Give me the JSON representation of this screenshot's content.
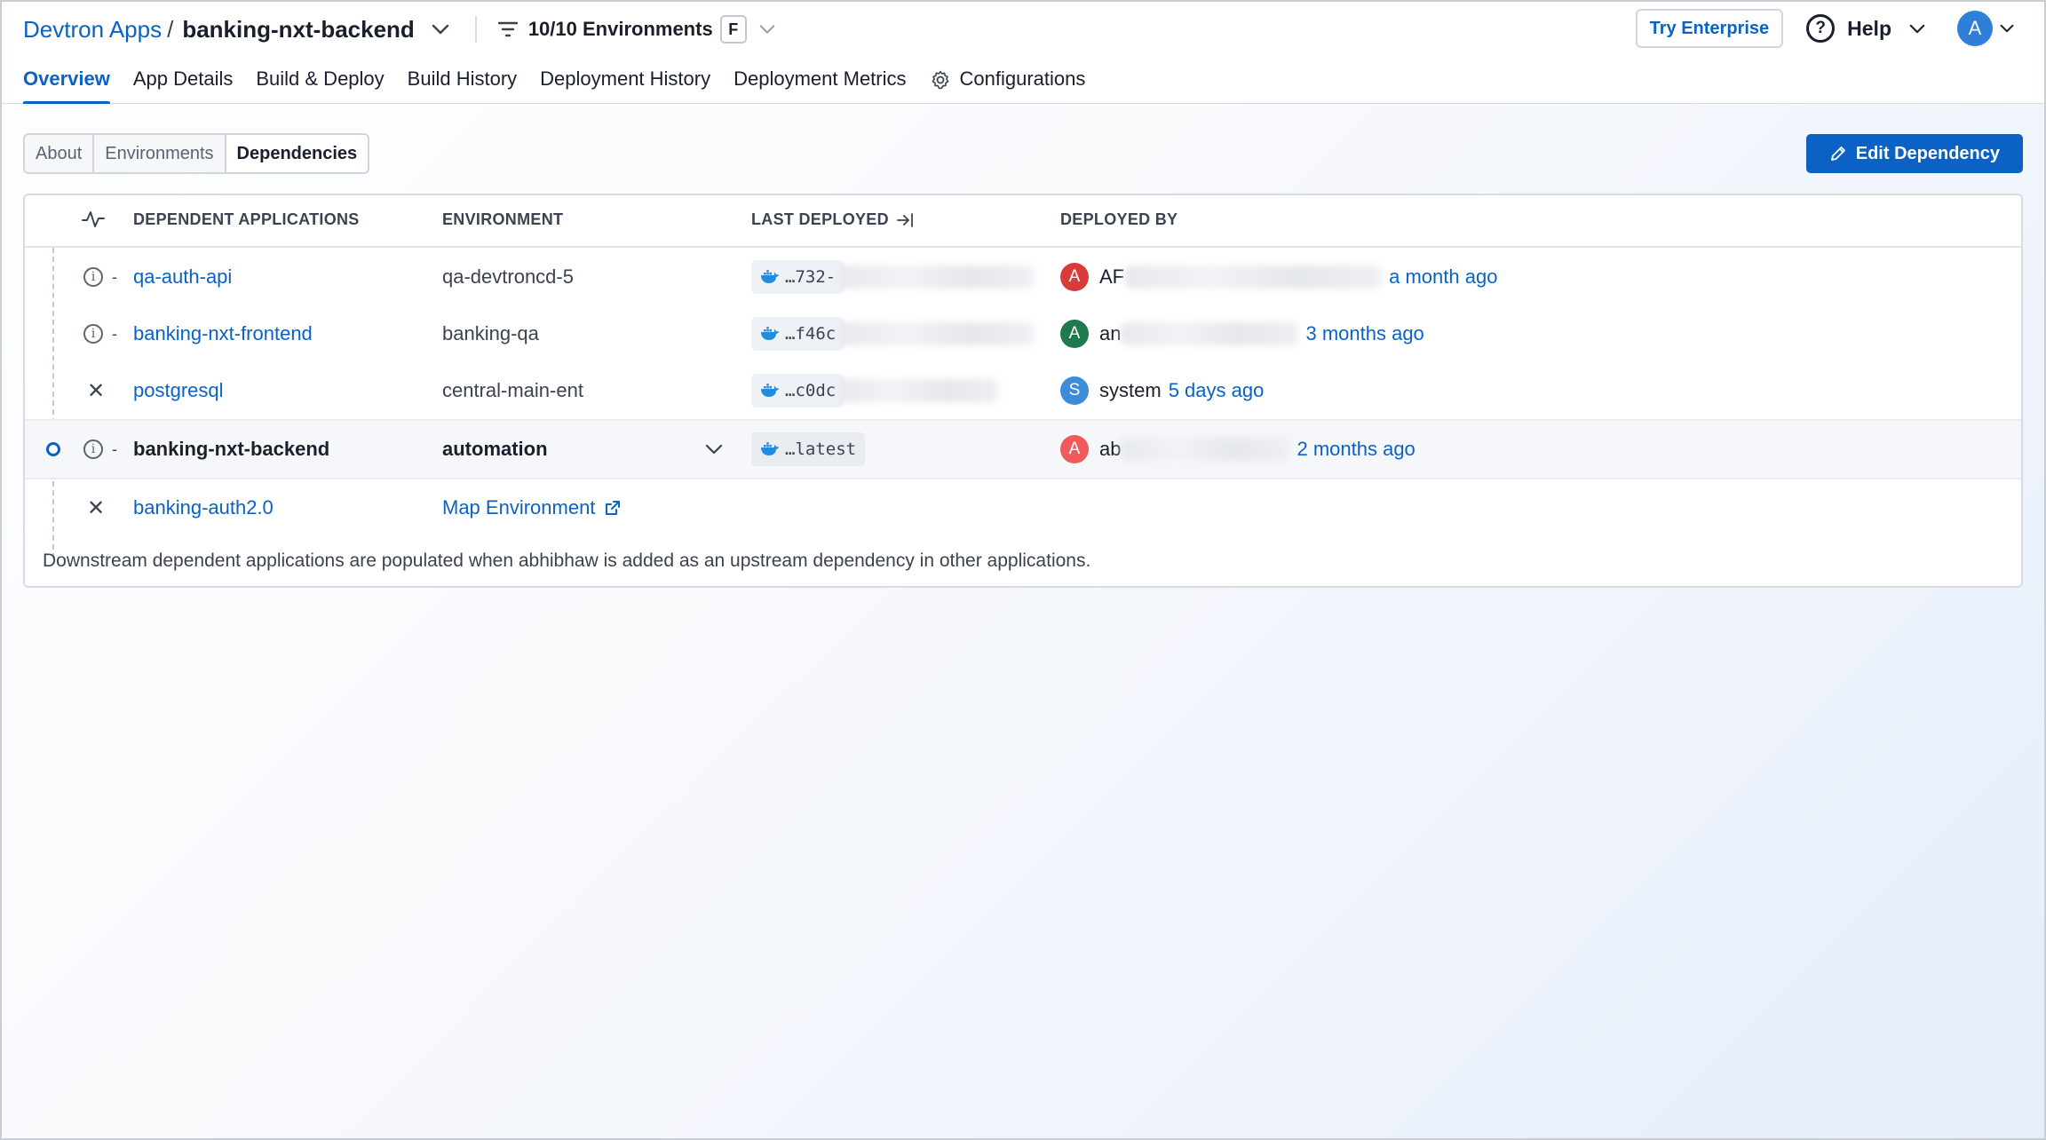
{
  "breadcrumb": {
    "root": "Devtron Apps",
    "separator": "/",
    "app": "banking-nxt-backend"
  },
  "env_filter": {
    "label": "10/10 Environments",
    "shortcut": "F"
  },
  "topright": {
    "enterprise": "Try Enterprise",
    "help": "Help",
    "avatar": "A"
  },
  "tabs": [
    {
      "label": "Overview",
      "active": true
    },
    {
      "label": "App Details"
    },
    {
      "label": "Build & Deploy"
    },
    {
      "label": "Build History"
    },
    {
      "label": "Deployment History"
    },
    {
      "label": "Deployment Metrics"
    },
    {
      "label": "Configurations",
      "icon": "gear-icon"
    }
  ],
  "segment": {
    "items": [
      "About",
      "Environments",
      "Dependencies"
    ],
    "active": "Dependencies"
  },
  "edit_button": "Edit Dependency",
  "table": {
    "headers": {
      "app": "DEPENDENT APPLICATIONS",
      "env": "ENVIRONMENT",
      "last": "LAST DEPLOYED",
      "by": "DEPLOYED BY"
    },
    "rows": [
      {
        "marker": "info",
        "dash": "-",
        "app": "qa-auth-api",
        "env": "qa-devtroncd-5",
        "image": "…732-",
        "avatar": "A",
        "avatar_color": "#d93a3a",
        "user": "AF",
        "time": "a month ago"
      },
      {
        "marker": "info",
        "dash": "-",
        "app": "banking-nxt-frontend",
        "env": "banking-qa",
        "image": "…f46c",
        "avatar": "A",
        "avatar_color": "#1e7a4a",
        "user": "an",
        "time": "3 months ago"
      },
      {
        "marker": "x",
        "app": "postgresql",
        "env": "central-main-ent",
        "image": "…c0dc",
        "avatar": "S",
        "avatar_color": "#3d8bd9",
        "user": "system",
        "time": "5 days ago"
      },
      {
        "marker": "info",
        "dash": "-",
        "app": "banking-nxt-backend",
        "env": "automation",
        "image": "…latest",
        "avatar": "A",
        "avatar_color": "#f05a5a",
        "user": "ab",
        "time": "2 months ago",
        "current": true
      },
      {
        "marker": "x",
        "app": "banking-auth2.0",
        "map_env": "Map Environment"
      }
    ],
    "footnote": "Downstream dependent applications are populated when abhibhaw is added as an upstream dependency in other applications."
  },
  "colors": {
    "accent": "#0b62c4"
  }
}
